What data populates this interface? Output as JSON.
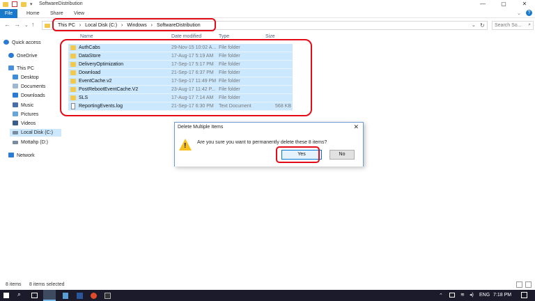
{
  "window": {
    "title": "SoftwareDistribution",
    "minimize_glyph": "—",
    "maximize_glyph": "▢",
    "close_glyph": "✕"
  },
  "ribbon": {
    "tabs": [
      "File",
      "Home",
      "Share",
      "View"
    ],
    "help_glyph": "?"
  },
  "address_bar": {
    "breadcrumbs": [
      "This PC",
      "Local Disk (C:)",
      "Windows",
      "SoftwareDistribution"
    ],
    "separator": "›",
    "search_placeholder": "Search So..."
  },
  "sidebar": {
    "items": [
      {
        "label": "Quick access",
        "icon": "star-icon"
      },
      {
        "label": "OneDrive",
        "icon": "cloud-icon"
      },
      {
        "label": "This PC",
        "icon": "computer-icon"
      },
      {
        "label": "Desktop",
        "icon": "desktop-icon"
      },
      {
        "label": "Documents",
        "icon": "documents-icon"
      },
      {
        "label": "Downloads",
        "icon": "downloads-icon"
      },
      {
        "label": "Music",
        "icon": "music-icon"
      },
      {
        "label": "Pictures",
        "icon": "pictures-icon"
      },
      {
        "label": "Videos",
        "icon": "videos-icon"
      },
      {
        "label": "Local Disk (C:)",
        "icon": "drive-icon"
      },
      {
        "label": "Mottahp (D:)",
        "icon": "drive-icon"
      },
      {
        "label": "Network",
        "icon": "network-icon"
      }
    ]
  },
  "file_list": {
    "columns": [
      "Name",
      "Date modified",
      "Type",
      "Size"
    ],
    "rows": [
      {
        "name": "AuthCabs",
        "date": "29-Nov-15 10:02 A...",
        "type": "File folder",
        "size": ""
      },
      {
        "name": "DataStore",
        "date": "17-Aug-17 5:19 AM",
        "type": "File folder",
        "size": ""
      },
      {
        "name": "DeliveryOptimization",
        "date": "17-Sep-17 5:17 PM",
        "type": "File folder",
        "size": ""
      },
      {
        "name": "Download",
        "date": "21-Sep-17 6:37 PM",
        "type": "File folder",
        "size": ""
      },
      {
        "name": "EventCache.v2",
        "date": "17-Sep-17 11:49 PM",
        "type": "File folder",
        "size": ""
      },
      {
        "name": "PostRebootEventCache.V2",
        "date": "23-Aug-17 11:42 P...",
        "type": "File folder",
        "size": ""
      },
      {
        "name": "SLS",
        "date": "17-Aug-17 7:14 AM",
        "type": "File folder",
        "size": ""
      },
      {
        "name": "ReportingEvents.log",
        "date": "21-Sep-17 6:30 PM",
        "type": "Text Document",
        "size": "568 KB"
      }
    ]
  },
  "dialog": {
    "title": "Delete Multiple Items",
    "close_glyph": "✕",
    "message": "Are you sure you want to permanently delete these 8 items?",
    "yes_label": "Yes",
    "no_label": "No",
    "icon": "warning-icon"
  },
  "status_bar": {
    "item_count": "8 items",
    "selected": "8 items selected"
  },
  "taskbar": {
    "language": "ENG",
    "time": "7:18 PM",
    "icons": [
      "start-icon",
      "search-icon",
      "task-view-icon",
      "file-explorer-icon",
      "store-icon",
      "word-icon",
      "chrome-icon",
      "terminal-icon"
    ]
  },
  "colors": {
    "accent": "#1979ca",
    "selection": "#cce8ff",
    "highlight_box": "#e30b17",
    "folder": "#f2c94c",
    "taskbar": "#1b1b2b"
  }
}
